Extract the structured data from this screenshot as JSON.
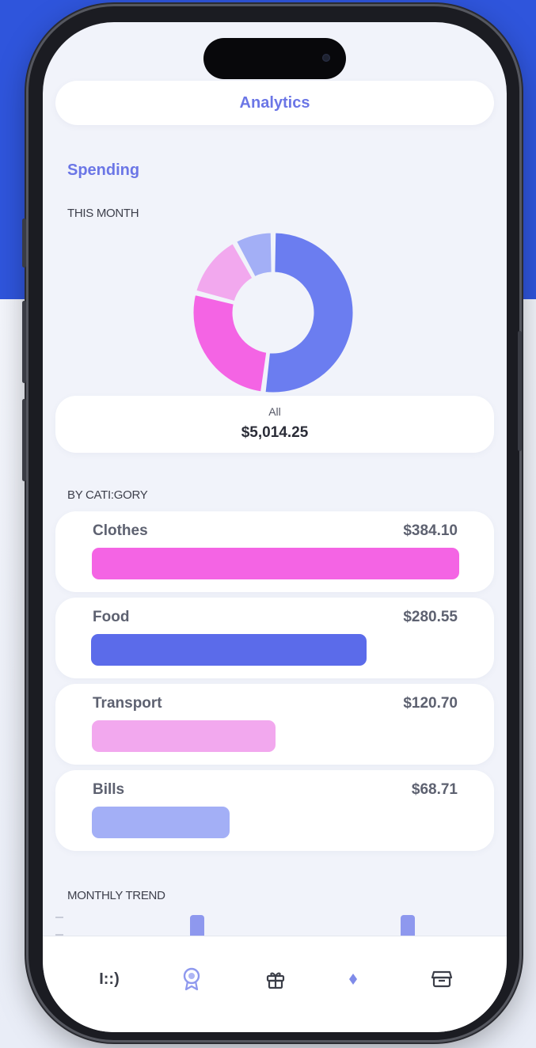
{
  "header": {
    "title": "Analytics"
  },
  "spending": {
    "heading": "Spending",
    "period_label": "THIS MONTH",
    "total_label": "All",
    "total_value": "$5,014.25"
  },
  "colors": {
    "accent": "#6b76e6",
    "clothes": "#f464e4",
    "food": "#5b6bea",
    "transport": "#f2a8ee",
    "bills": "#a3aff6",
    "background_top": "#2f55dc"
  },
  "chart_data": {
    "type": "pie",
    "variant": "donut",
    "slices": [
      {
        "label": "Food",
        "value": 52,
        "color": "#6b7df0"
      },
      {
        "label": "Clothes",
        "value": 27,
        "color": "#f464e4"
      },
      {
        "label": "Transport",
        "value": 13,
        "color": "#f2a8ee"
      },
      {
        "label": "Bills",
        "value": 8,
        "color": "#a3aff6"
      }
    ]
  },
  "by_category": {
    "label": "BY CATI:GORY",
    "items": [
      {
        "name": "Clothes",
        "amount": "$384.10",
        "fraction": 1.0,
        "color": "#f464e4"
      },
      {
        "name": "Food",
        "amount": "$280.55",
        "fraction": 0.75,
        "color": "#5b6bea"
      },
      {
        "name": "Transport",
        "amount": "$120.70",
        "fraction": 0.5,
        "color": "#f2a8ee"
      },
      {
        "name": "Bills",
        "amount": "$68.71",
        "fraction": 0.375,
        "color": "#a3aff6"
      }
    ]
  },
  "trend": {
    "label": "MONTHLY TREND"
  },
  "tabbar": {
    "tabs": [
      {
        "name": "tab-dashboard",
        "text": "I::)",
        "icon": "dashboard-text-icon"
      },
      {
        "name": "tab-rewards",
        "icon": "badge-icon"
      },
      {
        "name": "tab-gifts",
        "icon": "gift-icon"
      },
      {
        "name": "tab-premium",
        "icon": "diamond-icon"
      },
      {
        "name": "tab-store",
        "icon": "store-icon"
      }
    ]
  }
}
